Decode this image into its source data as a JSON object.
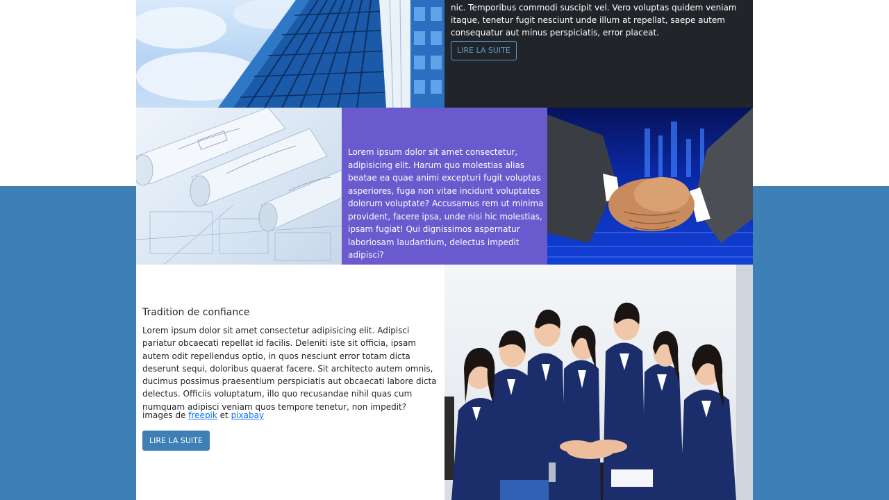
{
  "row1": {
    "text": "nic. Temporibus commodi suscipit vel. Vero voluptas quidem veniam itaque, tenetur fugit nesciunt unde illum at repellat, saepe autem consequatur aut minus perspiciatis, error placeat.",
    "button_label": "LIRE LA SUITE",
    "image_alt": "building-photo"
  },
  "row2": {
    "text": "Lorem ipsum dolor sit amet consectetur, adipisicing elit. Harum quo molestias alias beatae ea quae animi excepturi fugit voluptas asperiores, fuga non vitae incidunt voluptates dolorum voluptate? Accusamus rem ut minima provident, facere ipsa, unde nisi hic molestias, ipsam fugiat! Qui dignissimos aspernatur laboriosam laudantium, delectus impedit adipisci?",
    "left_image": "blueprint-photo",
    "right_image": "handshake-photo"
  },
  "row3": {
    "title": "Tradition de confiance",
    "body": "Lorem ipsum dolor sit amet consectetur adipisicing elit. Adipisci pariatur obcaecati repellat id facilis. Deleniti iste sit officia, ipsam autem odit repellendus optio, in quos nesciunt error totam dicta deserunt sequi, doloribus quaerat facere. Sit architecto autem omnis, ducimus possimus praesentium perspiciatis aut obcaecati labore dicta delectus. Officiis voluptatum, illo quo recusandae nihil quas cum numquam adipisci veniam quos tempore tenetur, non impedit?",
    "credit_prefix": "images de",
    "credit_link1": "freepik",
    "credit_mid": "et",
    "credit_link2": "pixabay",
    "button_label": "LIRE LA SUITE",
    "image": "team-photo"
  },
  "colors": {
    "band_blue": "#3e80b5",
    "dark": "#212529",
    "purple": "#6a5acd",
    "link": "#0d6efd"
  }
}
